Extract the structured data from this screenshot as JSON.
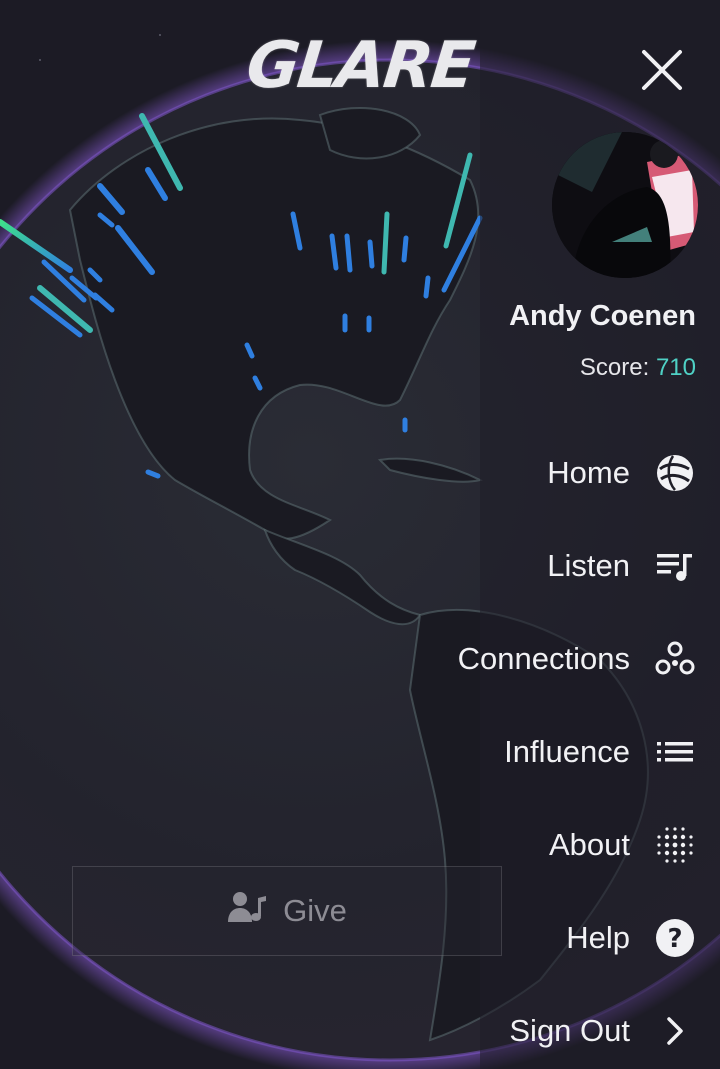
{
  "app": {
    "logo_text": "GLARE"
  },
  "give_button": {
    "label": "Give",
    "icon": "person-music-icon"
  },
  "drawer": {
    "close_icon": "close-icon",
    "user": {
      "name": "Andy Coenen",
      "score_label": "Score:",
      "score_value": "710"
    },
    "menu": [
      {
        "label": "Home",
        "icon": "globe-icon"
      },
      {
        "label": "Listen",
        "icon": "playlist-icon"
      },
      {
        "label": "Connections",
        "icon": "connections-icon"
      },
      {
        "label": "Influence",
        "icon": "list-icon"
      },
      {
        "label": "About",
        "icon": "dots-grid-icon"
      },
      {
        "label": "Help",
        "icon": "help-icon"
      },
      {
        "label": "Sign Out",
        "icon": "chevron-right-icon"
      }
    ]
  },
  "colors": {
    "background": "#1c1b25",
    "accent_score": "#4fd1c5",
    "globe_rim": "#8a5bd6",
    "bar_blue": "#2f7fe0",
    "bar_teal": "#3fb8b0",
    "bar_green": "#3ee08a"
  }
}
